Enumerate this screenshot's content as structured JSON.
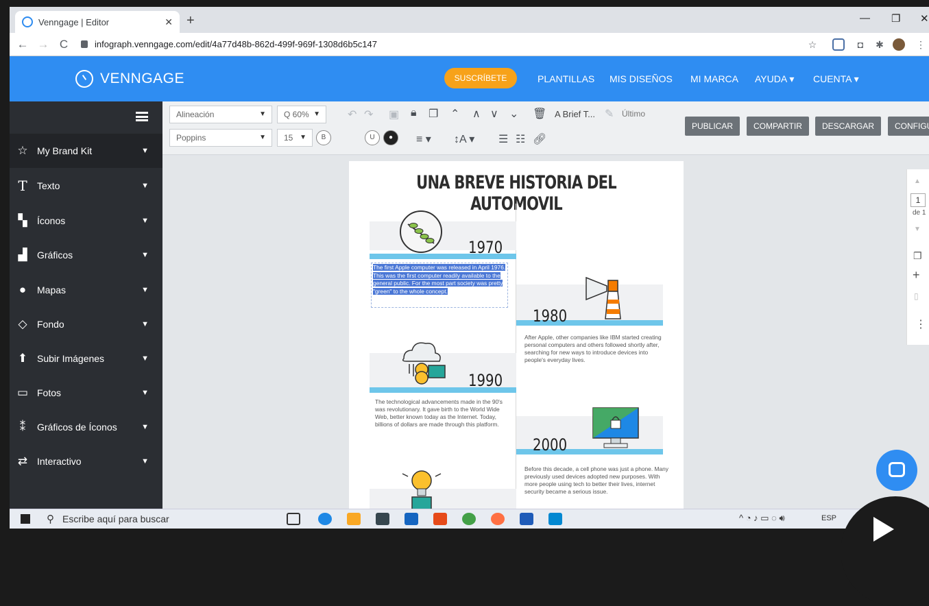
{
  "browser": {
    "tab_title": "Venngage | Editor",
    "url": "infograph.venngage.com/edit/4a77d48b-862d-499f-969f-1308d6b5c147"
  },
  "header": {
    "logo": "VENNGAGE",
    "subscribe": "SUSCRÍBETE",
    "nav": [
      "PLANTILLAS",
      "MIS DISEÑOS",
      "MI MARCA",
      "AYUDA ▾",
      "CUENTA ▾"
    ]
  },
  "sidebar": {
    "items": [
      {
        "label": "My Brand Kit",
        "icon": "star-icon"
      },
      {
        "label": "Texto",
        "icon": "text-icon"
      },
      {
        "label": "Íconos",
        "icon": "icons-icon"
      },
      {
        "label": "Gráficos",
        "icon": "bar-chart-icon"
      },
      {
        "label": "Mapas",
        "icon": "globe-icon"
      },
      {
        "label": "Fondo",
        "icon": "droplet-icon"
      },
      {
        "label": "Subir Imágenes",
        "icon": "upload-icon"
      },
      {
        "label": "Fotos",
        "icon": "photo-icon"
      },
      {
        "label": "Gráficos de Íconos",
        "icon": "pictograph-icon"
      },
      {
        "label": "Interactivo",
        "icon": "shuffle-icon"
      }
    ]
  },
  "toolbar": {
    "alignment": "Alineación",
    "zoom": "Q 60%",
    "font": "Poppins",
    "font_size": "15",
    "bold": "B",
    "underline": "U",
    "doc_name": "A Brief T...",
    "last_saved": "Último",
    "buttons": [
      "PUBLICAR",
      "COMPARTIR",
      "DESCARGAR",
      "CONFIGUR"
    ]
  },
  "canvas": {
    "title": "UNA BREVE HISTORIA DEL AUTOMOVIL",
    "entries": [
      {
        "year": "1970",
        "text": "The first Apple computer was released in April 1976. This was the first computer readily available to the general public. For the most part society was pretty \"green\" to the whole concept."
      },
      {
        "year": "1980",
        "text": "After Apple, other companies like IBM started creating personal computers and others followed shortly after, searching for new ways to introduce devices into people's everyday lives."
      },
      {
        "year": "1990",
        "text": "The technological advancements made in the 90's was revolutionary. It gave birth to the World Wide Web, better known today as the Internet. Today, billions of dollars are made through this platform."
      },
      {
        "year": "2000",
        "text": "Before this decade, a cell phone was just a phone. Many previously used devices adopted new purposes. With more people using tech to better their lives, internet security became a serious issue."
      }
    ]
  },
  "right_panel": {
    "page": "1",
    "of": "de 1"
  },
  "taskbar": {
    "search": "Escribe aquí para buscar",
    "lang": "ESP"
  },
  "colors": {
    "brand_blue": "#2f8df2",
    "accent_orange": "#f7a21a",
    "sidebar": "#2b2e33",
    "timeline_band": "#6ec6ea"
  }
}
